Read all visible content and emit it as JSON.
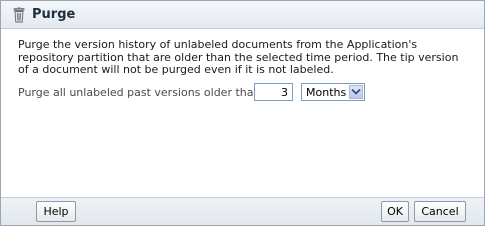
{
  "dialog": {
    "title": "Purge",
    "title_icon": "trash-bin-icon"
  },
  "content": {
    "description": "Purge the version history of unlabeled documents from the Application's repository partition that are older than the selected time period. The tip version of a document will not be purged even if it is not labeled.",
    "age_label": "Purge all unlabeled past versions older than :",
    "age_value": "3",
    "unit_selected": "Months",
    "unit_dropdown_icon": "chevron-down-icon"
  },
  "footer": {
    "help_label": "Help",
    "ok_label": "OK",
    "cancel_label": "Cancel"
  }
}
